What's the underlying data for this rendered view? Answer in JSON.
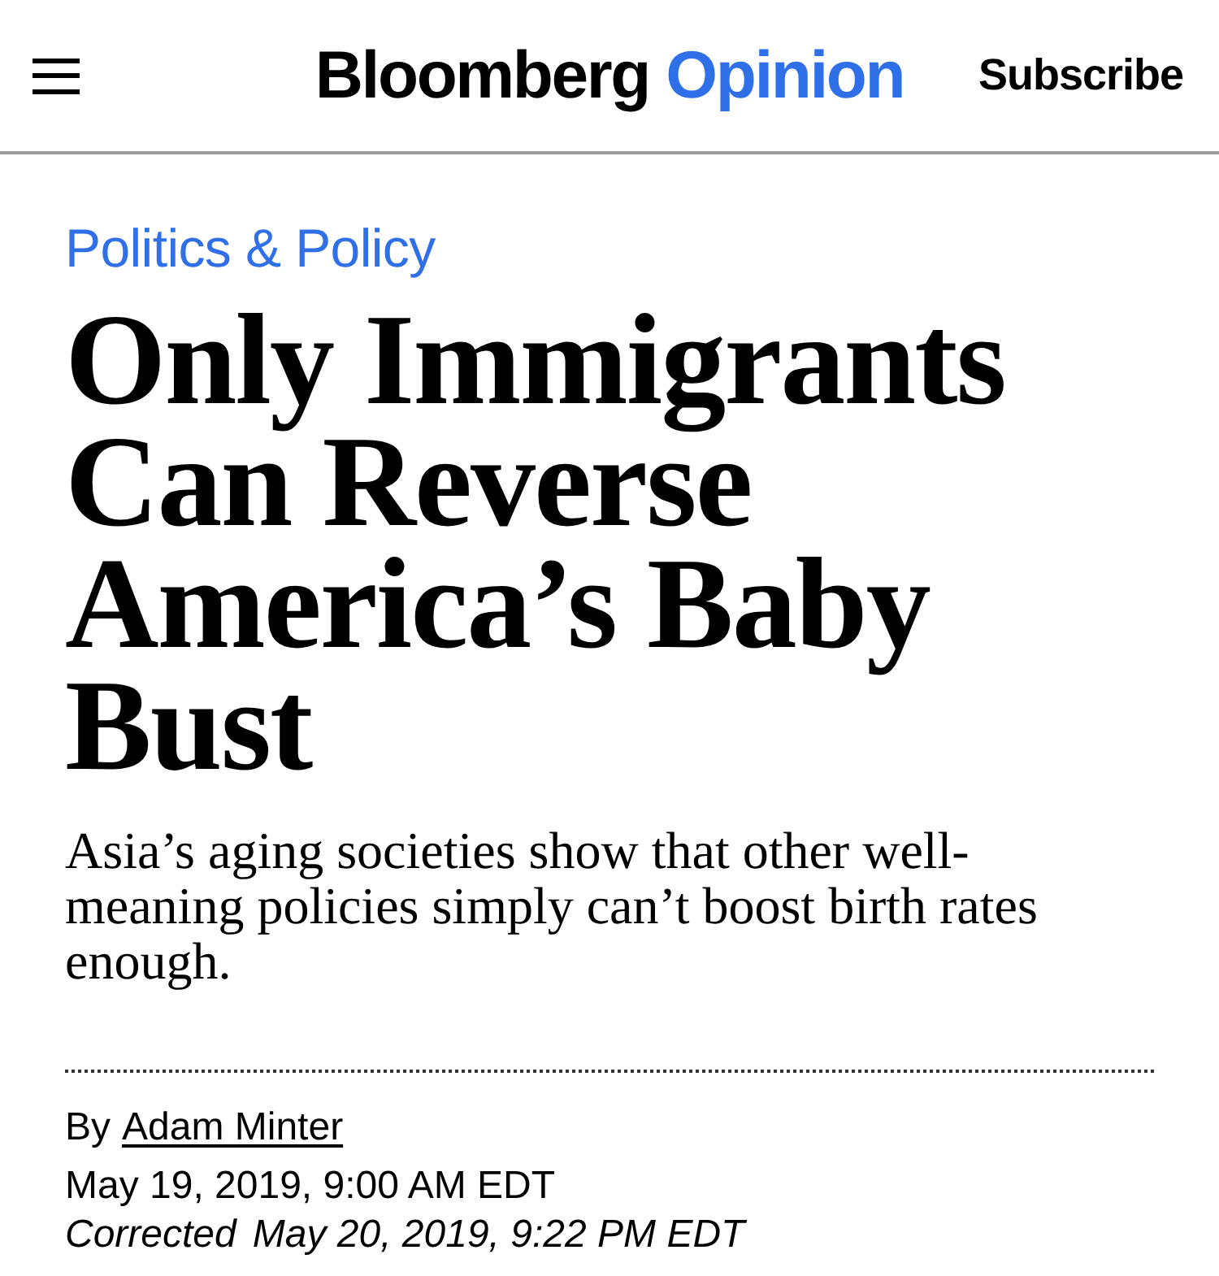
{
  "header": {
    "logo": {
      "brand": "Bloomberg",
      "section": "Opinion"
    },
    "subscribe": "Subscribe"
  },
  "article": {
    "category": "Politics & Policy",
    "headline": "Only Immigrants Can Reverse America’s Baby Bust",
    "dek": "Asia’s aging societies show that other well-meaning policies simply can’t boost birth rates enough.",
    "byline": {
      "prefix": "By",
      "author": "Adam Minter"
    },
    "published": "May 19, 2019, 9:00 AM EDT",
    "corrected": {
      "label": "Corrected",
      "date": "May 20, 2019, 9:22 PM EDT"
    }
  }
}
